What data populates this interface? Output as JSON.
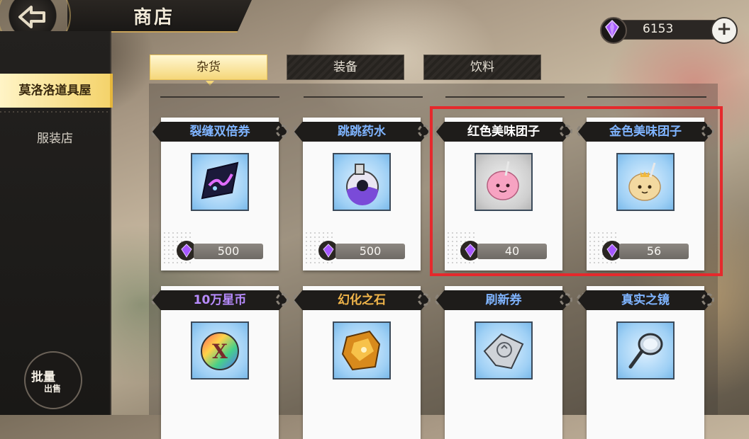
{
  "header": {
    "title": "商店",
    "currency_amount": "6153"
  },
  "sidebar": {
    "items": [
      {
        "label": "莫洛洛道具屋",
        "active": true
      },
      {
        "label": "服装店",
        "active": false
      }
    ],
    "bulk_sell": {
      "line1": "批量",
      "line2": "出售"
    }
  },
  "tabs": [
    {
      "label": "杂货",
      "active": true
    },
    {
      "label": "装备",
      "active": false
    },
    {
      "label": "饮料",
      "active": false
    }
  ],
  "items": [
    {
      "name": "裂缝双倍券",
      "name_color": "#7fb4ff",
      "price": "500",
      "icon": "ticket-icon",
      "frame": "blue"
    },
    {
      "name": "跳跳药水",
      "name_color": "#7fb4ff",
      "price": "500",
      "icon": "potion-icon",
      "frame": "blue"
    },
    {
      "name": "红色美味团子",
      "name_color": "#ffffff",
      "price": "40",
      "icon": "pink-dango-icon",
      "frame": "gray"
    },
    {
      "name": "金色美味团子",
      "name_color": "#7fb4ff",
      "price": "56",
      "icon": "golden-dango-icon",
      "frame": "blue"
    },
    {
      "name": "10万星币",
      "name_color": "#b88cff",
      "price": "",
      "icon": "star-coin-icon",
      "frame": "blue"
    },
    {
      "name": "幻化之石",
      "name_color": "#f2b64a",
      "price": "",
      "icon": "transform-stone-icon",
      "frame": "blue"
    },
    {
      "name": "刷新券",
      "name_color": "#7fb4ff",
      "price": "",
      "icon": "refresh-ticket-icon",
      "frame": "blue"
    },
    {
      "name": "真实之镜",
      "name_color": "#7fb4ff",
      "price": "",
      "icon": "mirror-icon",
      "frame": "blue"
    }
  ],
  "colors": {
    "accent_gold": "#f5d77a",
    "highlight_red": "#e5292c",
    "gem_purple": "#a657ff"
  }
}
